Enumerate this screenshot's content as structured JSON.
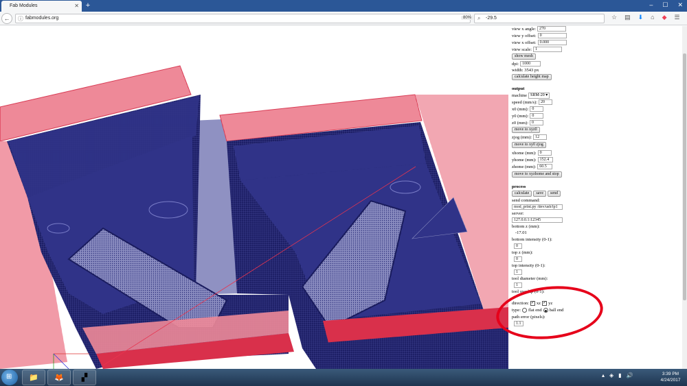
{
  "browser": {
    "tab_title": "Fab Modules",
    "url": "fabmodules.org",
    "zoom": "80%",
    "search_value": "-29.5"
  },
  "panel": {
    "view": {
      "x_angle_label": "view x angle:",
      "x_angle": "270",
      "y_offset_label": "view y offset:",
      "y_offset": "0",
      "x_offset_label": "view x offset:",
      "x_offset": "0.000",
      "scale_label": "view scale:",
      "scale": "1",
      "show_mesh": "show mesh",
      "dpi_label": "dpi:",
      "dpi": "1000",
      "width_text": "width: 3543 px",
      "calc_height_map": "calculate height map"
    },
    "output": {
      "title": "output",
      "machine_label": "machine",
      "machine": "SRM-20",
      "speed_label": "speed (mm/s):",
      "speed": "20",
      "x0_label": "x0 (mm):",
      "x0": "0",
      "y0_label": "y0 (mm):",
      "y0": "0",
      "z0_label": "z0 (mm):",
      "z0": "0",
      "move_xyz0": "move to xyz0",
      "zjog_label": "zjog (mm):",
      "zjog": "12",
      "move_xy0_zjog": "move to xy0 zjog",
      "xhome_label": "xhome (mm):",
      "xhome": "0",
      "yhome_label": "yhome (mm):",
      "yhome": "152.4",
      "zhome_label": "zhome (mm):",
      "zhome": "60.5",
      "move_home_stop": "move to xyzhome and stop"
    },
    "process": {
      "title": "process",
      "calculate": "calculate",
      "save": "save",
      "send": "send",
      "send_command_label": "send command:",
      "send_command": "mod_print.py /dev/usb/lp1",
      "server_label": "server:",
      "server": "127.0.0.1:12345",
      "bottom_z_label": "bottom z (mm):",
      "bottom_z": "-17.01",
      "bottom_intensity_label": "bottom intensity (0-1):",
      "bottom_intensity": "0",
      "top_z_label": "top z (mm):",
      "top_z": "0",
      "top_intensity_label": "top intensity (0-1):",
      "top_intensity": "1",
      "tool_diameter_label": "tool diameter (mm):",
      "tool_diameter": "1",
      "tool_overlap_label": "tool overlap (0-1):",
      "direction_label": "direction:",
      "dir_xz": "xz",
      "dir_yz": "yz",
      "type_label": "type:",
      "flat_end": "flat end",
      "ball_end": "ball end",
      "path_error_label": "path error (pixels):",
      "path_error": "1.1"
    }
  },
  "taskbar": {
    "time": "3:39 PM",
    "date": "4/24/2017"
  },
  "colors": {
    "mesh_blue": "#1d1f66",
    "mesh_red": "#e8556a",
    "annotation_red": "#e6001a",
    "tabbar": "#2b5797"
  }
}
